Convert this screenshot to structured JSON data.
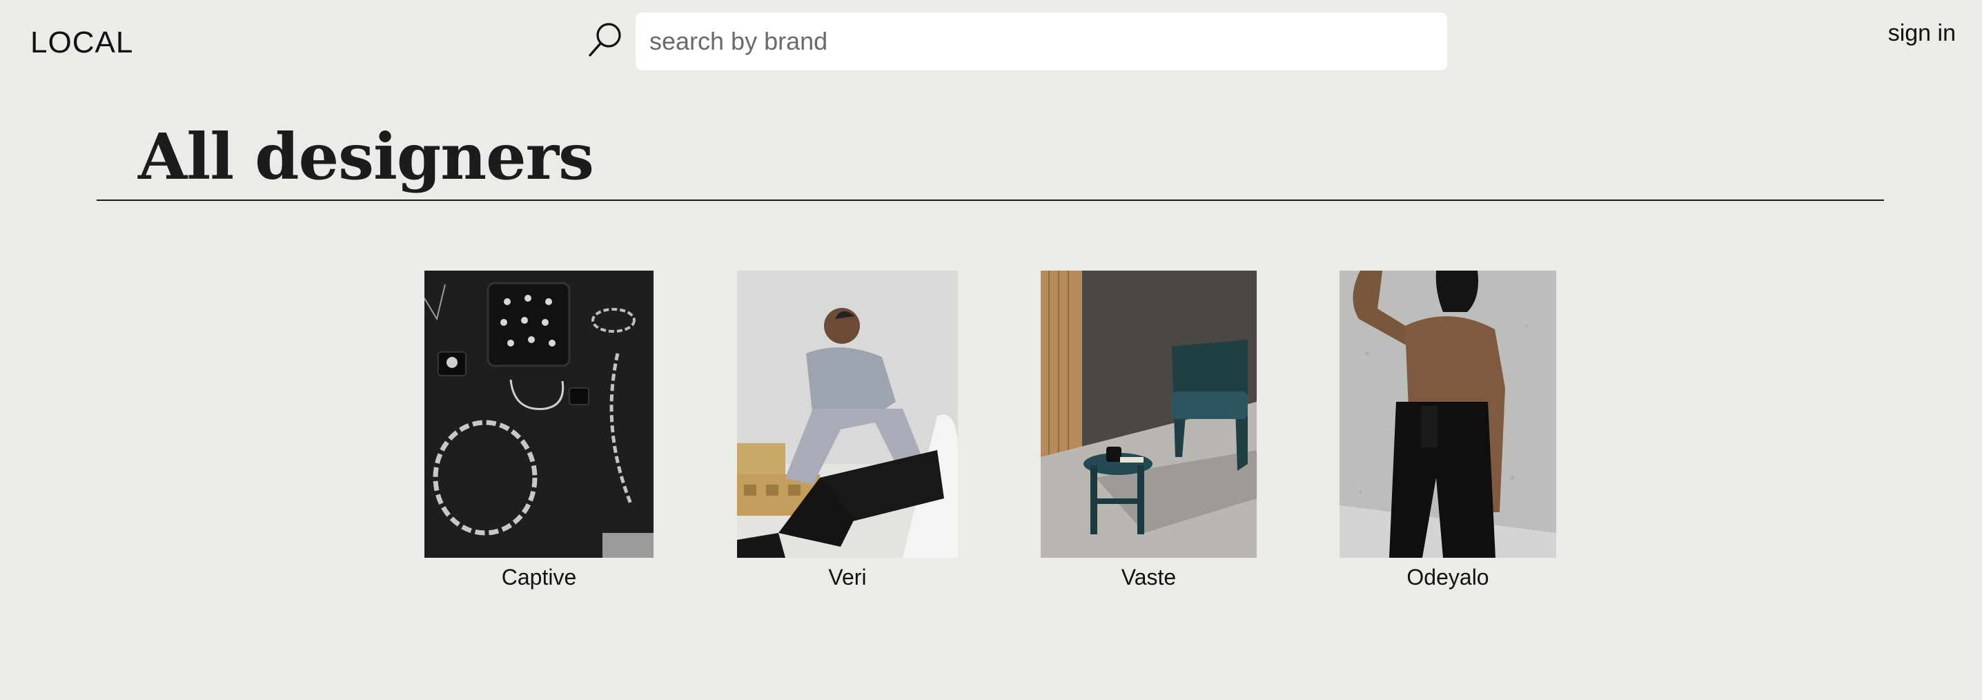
{
  "header": {
    "logo": "LOCAL",
    "search_placeholder": "search by brand",
    "search_value": "",
    "sign_in_label": "sign in"
  },
  "page": {
    "title": "All designers"
  },
  "designers": [
    {
      "name": "Captive",
      "image": "jewelry-flatlay-photo"
    },
    {
      "name": "Veri",
      "image": "seated-models-photo"
    },
    {
      "name": "Vaste",
      "image": "green-chair-side-table-photo"
    },
    {
      "name": "Odeyalo",
      "image": "brown-turtleneck-model-photo"
    }
  ],
  "colors": {
    "background": "#ebebe8",
    "text": "#111111",
    "search_field": "#ffffff"
  },
  "icons": {
    "search": "search-icon"
  }
}
